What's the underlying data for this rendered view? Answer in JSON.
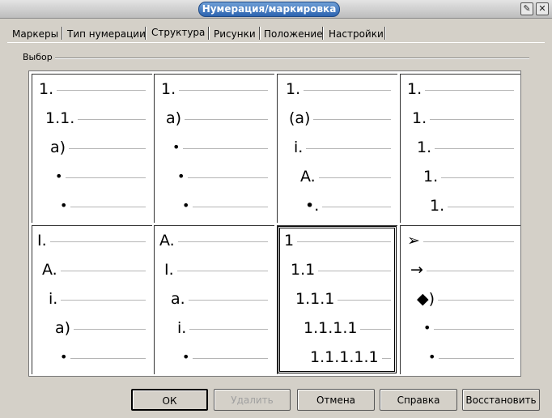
{
  "window": {
    "title": "Нумерация/маркировка",
    "pin_icon": "pin-icon",
    "close_icon": "close-icon"
  },
  "tabs": [
    {
      "label": "Маркеры",
      "active": false
    },
    {
      "label": "Тип нумерации",
      "active": false
    },
    {
      "label": "Структура",
      "active": true
    },
    {
      "label": "Рисунки",
      "active": false
    },
    {
      "label": "Положение",
      "active": false
    },
    {
      "label": "Настройки",
      "active": false
    }
  ],
  "selection": {
    "group_label": "Выбор",
    "selected_index": 6,
    "cells": [
      {
        "levels": [
          "1.",
          "1.1.",
          "a)",
          "•",
          "•"
        ]
      },
      {
        "levels": [
          "1.",
          "a)",
          "•",
          "•",
          "•"
        ]
      },
      {
        "levels": [
          "1.",
          "(a)",
          "i.",
          "A.",
          "•."
        ]
      },
      {
        "levels": [
          "1.",
          "1.",
          "1.",
          "1.",
          "1."
        ]
      },
      {
        "levels": [
          "I.",
          "A.",
          "i.",
          "a)",
          "•"
        ]
      },
      {
        "levels": [
          "A.",
          "I.",
          "a.",
          "i.",
          "•"
        ]
      },
      {
        "levels": [
          "1",
          "1.1",
          "1.1.1",
          "1.1.1.1",
          "1.1.1.1.1"
        ]
      },
      {
        "levels": [
          "➢",
          "→",
          "◆)",
          "•",
          "•"
        ]
      }
    ]
  },
  "buttons": {
    "ok": "ОК",
    "delete": "Удалить",
    "cancel": "Отмена",
    "help": "Справка",
    "reset": "Восстановить"
  }
}
